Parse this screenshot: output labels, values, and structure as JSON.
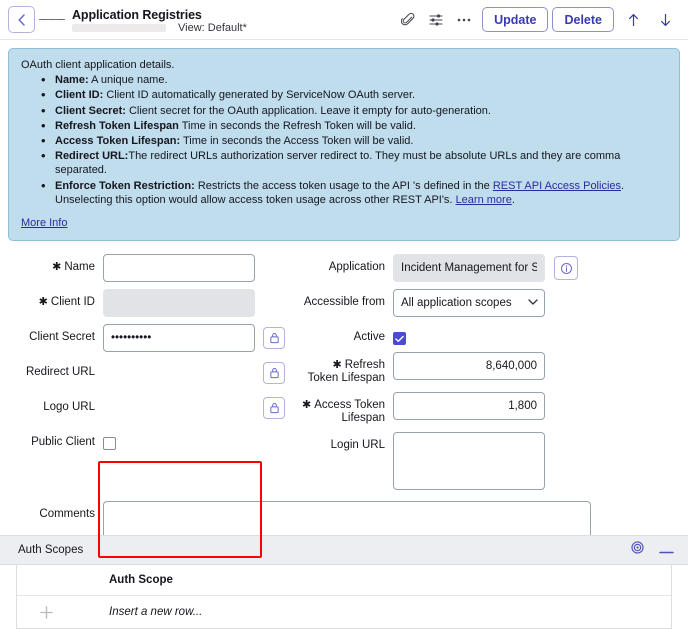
{
  "titlebar": {
    "back_icon": "chevron-left-icon",
    "menu_icon": "hamburger-menu-icon",
    "record_title": "Application Registries",
    "view_label": "View: Default*",
    "attachment_icon": "paperclip-icon",
    "personalize_icon": "sliders-icon",
    "more_icon": "ellipsis-icon",
    "update_label": "Update",
    "delete_label": "Delete",
    "prev_icon": "arrow-up-icon",
    "next_icon": "arrow-down-icon"
  },
  "banner": {
    "lead": "OAuth client application details.",
    "items": [
      {
        "term": "Name:",
        "text": " A unique name."
      },
      {
        "term": "Client ID:",
        "text": " Client ID automatically generated by ServiceNow OAuth server."
      },
      {
        "term": "Client Secret:",
        "text": " Client secret for the OAuth application. Leave it empty for auto-generation."
      },
      {
        "term": "Refresh Token Lifespan",
        "text": " Time in seconds the Refresh Token will be valid."
      },
      {
        "term": "Access Token Lifespan:",
        "text": " Time in seconds the Access Token will be valid."
      },
      {
        "term": "Redirect URL:",
        "text": "The redirect URLs authorization server redirect to. They must be absolute URLs and they are comma separated."
      }
    ],
    "enforce_term": "Enforce Token Restriction:",
    "enforce_text_1": " Restricts the access token usage to the API 's defined in the ",
    "enforce_link_1": "REST API Access Policies",
    "enforce_text_2": ".",
    "enforce_text_3": "Unselecting this option would allow access token usage across other REST API's. ",
    "enforce_link_2": "Learn more",
    "enforce_text_4": ".",
    "more_info": "More Info"
  },
  "form": {
    "left": {
      "name_label": "Name",
      "name_value": "",
      "client_id_label": "Client ID",
      "client_id_value": "",
      "client_secret_label": "Client Secret",
      "client_secret_value": "••••••••••",
      "redirect_url_label": "Redirect URL",
      "redirect_url_value": "",
      "logo_url_label": "Logo URL",
      "logo_url_value": "",
      "public_client_label": "Public Client",
      "public_client_checked": false,
      "comments_label": "Comments",
      "comments_value": "",
      "required_marker": "✱",
      "lock_icon": "padlock-icon"
    },
    "right": {
      "application_label": "Application",
      "application_value": "Incident Management for Se",
      "info_icon": "info-circle-icon",
      "accessible_from_label": "Accessible from",
      "accessible_from_value": "All application scopes",
      "accessible_from_options": [
        "All application scopes"
      ],
      "active_label": "Active",
      "active_checked": true,
      "refresh_token_label": "Refresh Token Lifespan",
      "refresh_token_value": "8,640,000",
      "access_token_label": "Access Token Lifespan",
      "access_token_value": "1,800",
      "login_url_label": "Login URL",
      "login_url_value": ""
    }
  },
  "auth_scopes": {
    "section_title": "Auth Scopes",
    "settings_icon": "gear-icon",
    "collapse_icon": "minus-icon",
    "column_header": "Auth Scope",
    "add_icon": "plus-icon",
    "insert_row_label": "Insert a new row..."
  },
  "colors": {
    "accent": "#3a3ab0",
    "banner_bg": "#bfdded",
    "highlight": "#ff0000",
    "checkbox_on": "#4b4bd0"
  }
}
